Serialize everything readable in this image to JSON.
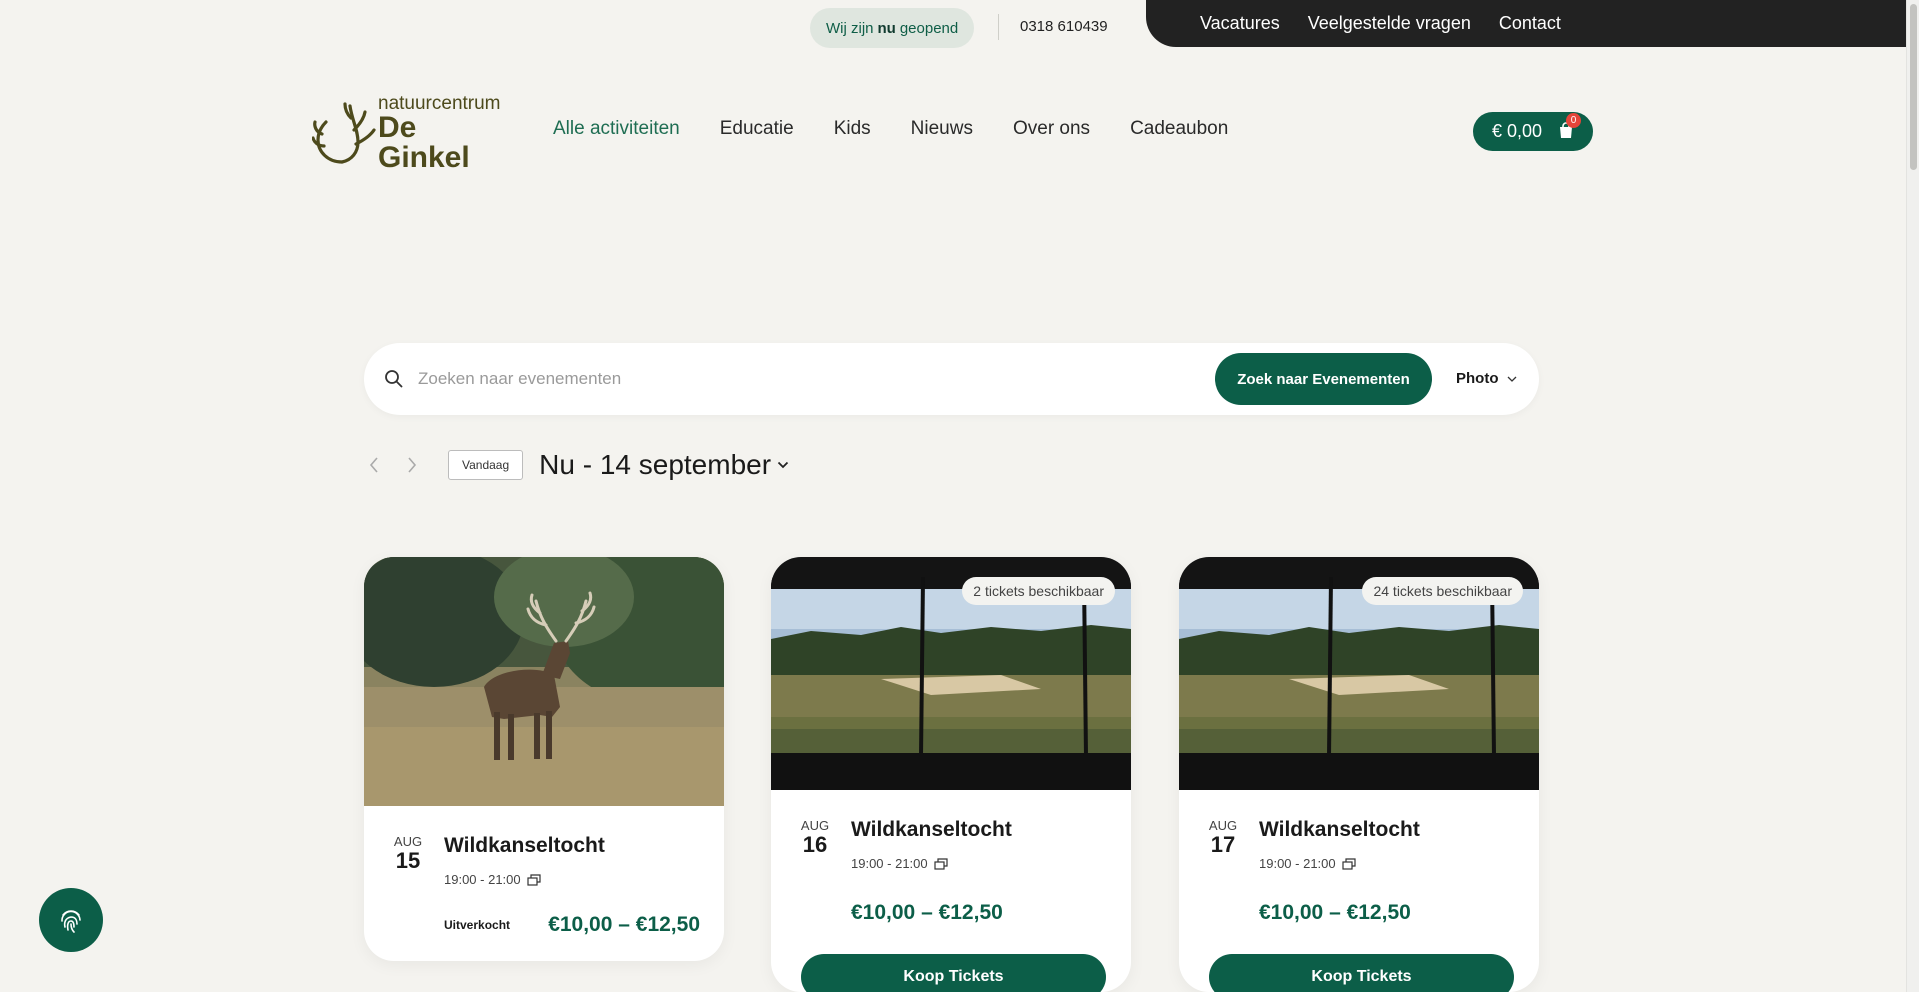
{
  "topbar": {
    "open_status_prefix": "Wij zijn",
    "open_status_bold": "nu",
    "open_status_suffix": "geopend",
    "phone": "0318 610439",
    "links": [
      "Vacatures",
      "Veelgestelde vragen",
      "Contact"
    ]
  },
  "logo": {
    "line1": "natuurcentrum",
    "line2": "De Ginkel"
  },
  "nav": {
    "items": [
      "Alle activiteiten",
      "Educatie",
      "Kids",
      "Nieuws",
      "Over ons",
      "Cadeaubon"
    ],
    "active": "Alle activiteiten"
  },
  "cart": {
    "total": "€ 0,00",
    "count": "0"
  },
  "search": {
    "placeholder": "Zoeken naar evenementen",
    "button_label": "Zoek naar Evenementen",
    "view_label": "Photo"
  },
  "datebar": {
    "today_label": "Vandaag",
    "range_label": "Nu - 14 september"
  },
  "events": [
    {
      "month": "AUG",
      "day": "15",
      "title": "Wildkanseltocht",
      "time": "19:00 - 21:00",
      "price": "€10,00 – €12,50",
      "status": "Uitverkocht",
      "tickets": "",
      "image": "deer"
    },
    {
      "month": "AUG",
      "day": "16",
      "title": "Wildkanseltocht",
      "time": "19:00 - 21:00",
      "price": "€10,00 – €12,50",
      "status": "",
      "tickets": "2 tickets beschikbaar",
      "button_label": "Koop Tickets",
      "image": "hide-view"
    },
    {
      "month": "AUG",
      "day": "17",
      "title": "Wildkanseltocht",
      "time": "19:00 - 21:00",
      "price": "€10,00 – €12,50",
      "status": "",
      "tickets": "24 tickets beschikbaar",
      "button_label": "Koop Tickets",
      "image": "hide-view"
    }
  ],
  "colors": {
    "brand_green": "#0c5e48",
    "page_bg": "#f4f3ef",
    "dark_bar": "#222222",
    "badge_red": "#e4453a"
  },
  "icons": [
    "search-icon",
    "chevron-down-icon",
    "chevron-left-icon",
    "chevron-right-icon",
    "cart-icon",
    "recurring-icon",
    "fingerprint-icon"
  ]
}
